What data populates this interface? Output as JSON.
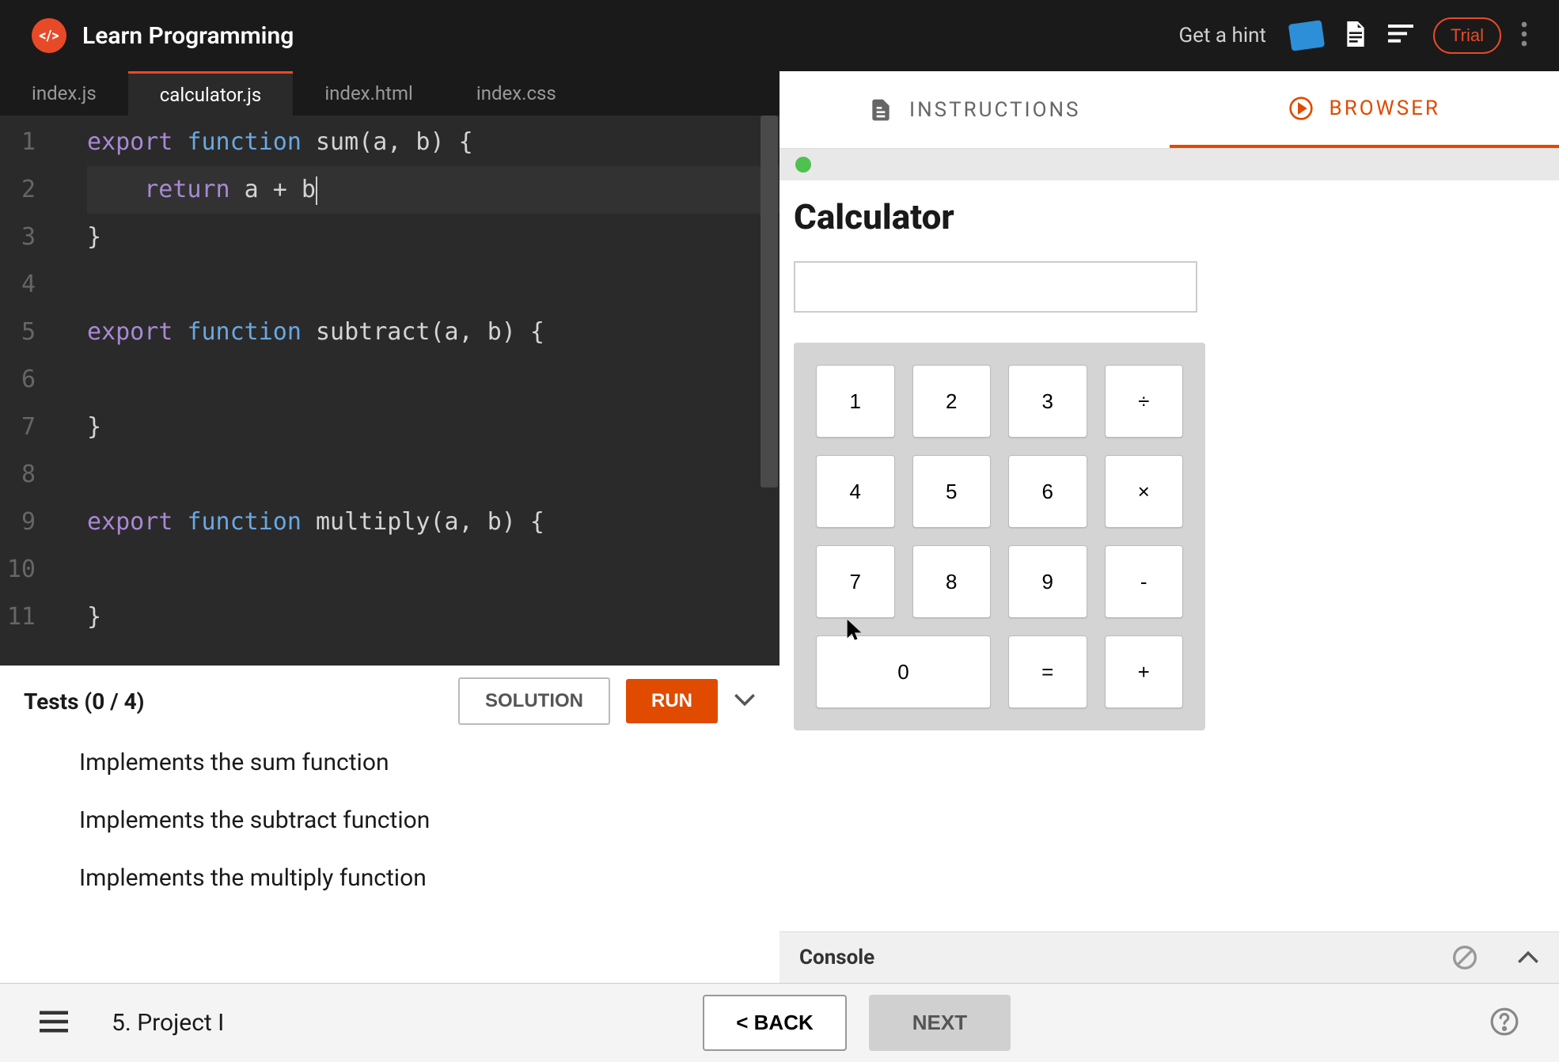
{
  "header": {
    "title": "Learn Programming",
    "hint": "Get a hint",
    "trial": "Trial"
  },
  "editor": {
    "tabs": [
      "index.js",
      "calculator.js",
      "index.html",
      "index.css"
    ],
    "active_tab": 1,
    "lines": [
      "1",
      "2",
      "3",
      "4",
      "5",
      "6",
      "7",
      "8",
      "9",
      "10",
      "11"
    ],
    "code": {
      "l1": {
        "export": "export",
        "function": "function",
        "rest": " sum(a, b) {"
      },
      "l2": {
        "return": "return",
        "rest": " a + b"
      },
      "l3": "}",
      "l5": {
        "export": "export",
        "function": "function",
        "rest": " subtract(a, b) {"
      },
      "l7": "}",
      "l9": {
        "export": "export",
        "function": "function",
        "rest": " multiply(a, b) {"
      },
      "l11": "}"
    }
  },
  "tests": {
    "title": "Tests (0 / 4)",
    "solution": "SOLUTION",
    "run": "RUN",
    "items": [
      "Implements the sum function",
      "Implements the subtract function",
      "Implements the multiply function"
    ]
  },
  "preview": {
    "tabs": {
      "instructions": "INSTRUCTIONS",
      "browser": "BROWSER"
    },
    "calc_title": "Calculator",
    "buttons": [
      "1",
      "2",
      "3",
      "÷",
      "4",
      "5",
      "6",
      "×",
      "7",
      "8",
      "9",
      "-",
      "0",
      "=",
      "+"
    ]
  },
  "console": {
    "label": "Console"
  },
  "footer": {
    "project": "5. Project I",
    "back": "< BACK",
    "next": "NEXT"
  }
}
